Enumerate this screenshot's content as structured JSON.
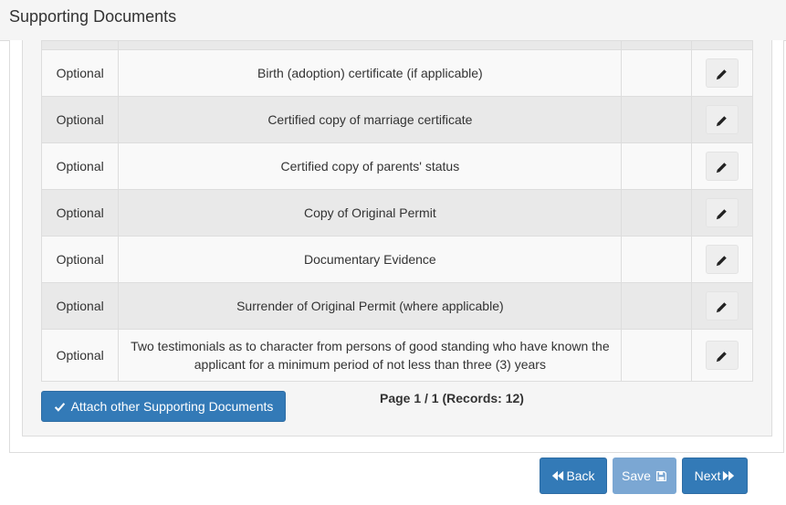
{
  "header": {
    "title": "Supporting Documents"
  },
  "documents": {
    "rows": [
      {
        "status": "Optional",
        "name": "Birth (adoption) certificate (if applicable)"
      },
      {
        "status": "Optional",
        "name": "Certified copy of marriage certificate"
      },
      {
        "status": "Optional",
        "name": "Certified copy of parents' status"
      },
      {
        "status": "Optional",
        "name": "Copy of Original Permit"
      },
      {
        "status": "Optional",
        "name": "Documentary Evidence"
      },
      {
        "status": "Optional",
        "name": "Surrender of Original Permit (where applicable)"
      },
      {
        "status": "Optional",
        "name": "Two testimonials as to character from persons of good standing who have known the applicant for a minimum period of not less than three (3) years"
      }
    ]
  },
  "actions": {
    "attach_label": "Attach other Supporting Documents",
    "pager_text": "Page 1 / 1 (Records: 12)"
  },
  "footer": {
    "back_label": "Back",
    "save_label": "Save",
    "next_label": "Next"
  },
  "icons": {
    "edit": "pencil-icon",
    "attach": "check-icon",
    "back": "backward-icon",
    "save": "floppy-disk-icon",
    "next": "forward-icon"
  },
  "colors": {
    "primary": "#337ab7",
    "primary_disabled": "#7ba7d3",
    "row_even": "#e9e9e9",
    "row_odd": "#f9f9f9"
  }
}
